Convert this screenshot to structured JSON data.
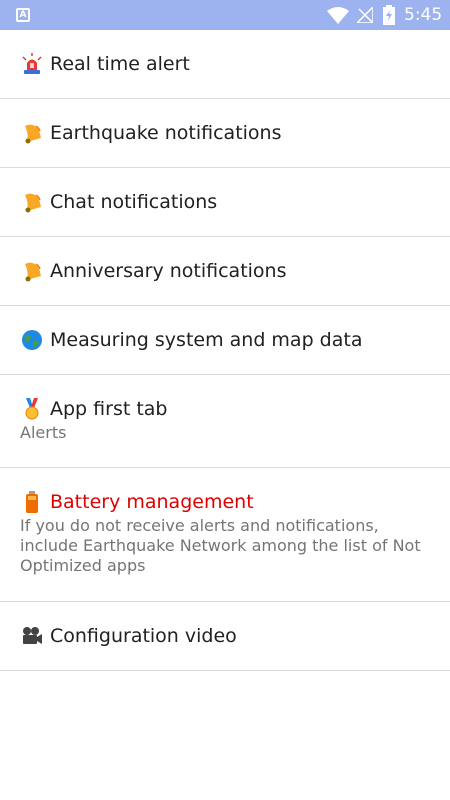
{
  "status_bar": {
    "app_badge": "A",
    "time": "5:45",
    "icons": [
      "wifi-icon",
      "no-signal-icon",
      "battery-charging-icon"
    ]
  },
  "settings": [
    {
      "title": "Real time alert",
      "icon": "siren-icon"
    },
    {
      "title": "Earthquake notifications",
      "icon": "bell-icon"
    },
    {
      "title": "Chat notifications",
      "icon": "bell-icon"
    },
    {
      "title": "Anniversary notifications",
      "icon": "bell-icon"
    },
    {
      "title": "Measuring system and map data",
      "icon": "globe-icon"
    },
    {
      "title": "App first tab",
      "summary": "Alerts",
      "icon": "medal-icon"
    },
    {
      "title": "Battery management",
      "summary": "If you do not receive alerts and notifications, include Earthquake Network among the list of Not Optimized apps",
      "icon": "battery-icon",
      "title_color": "#e00000"
    },
    {
      "title": "Configuration video",
      "icon": "video-camera-icon"
    }
  ],
  "colors": {
    "status_bar": "#9cb3ef",
    "title": "#212121",
    "summary": "#757575",
    "divider": "#dcdcdc",
    "warning": "#e00000"
  }
}
